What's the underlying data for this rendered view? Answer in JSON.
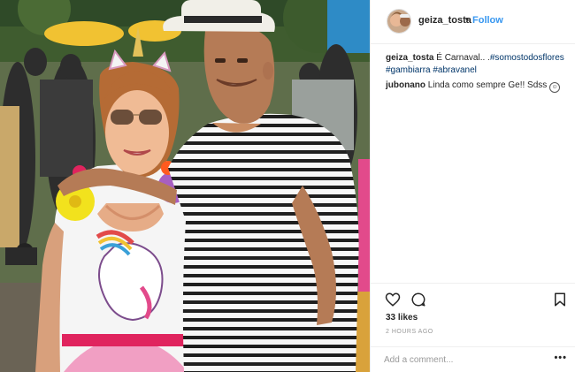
{
  "post": {
    "username": "geiza_tosta",
    "separator": "•",
    "follow_label": "Follow",
    "comments": [
      {
        "user": "geiza_tosta",
        "text": "É Carnaval.. .",
        "hashtags": [
          "#somostodosflores",
          "#gambiarra",
          "#abravanel"
        ]
      },
      {
        "user": "jubonano",
        "text": "Linda como sempre Ge!! Sdss"
      }
    ],
    "likes": "33 likes",
    "timestamp": "2 HOURS AGO",
    "comment_placeholder": "Add a comment...",
    "more_label": "•••",
    "icons": [
      "heart-icon",
      "comment-icon",
      "bookmark-icon",
      "more-options-icon"
    ]
  }
}
